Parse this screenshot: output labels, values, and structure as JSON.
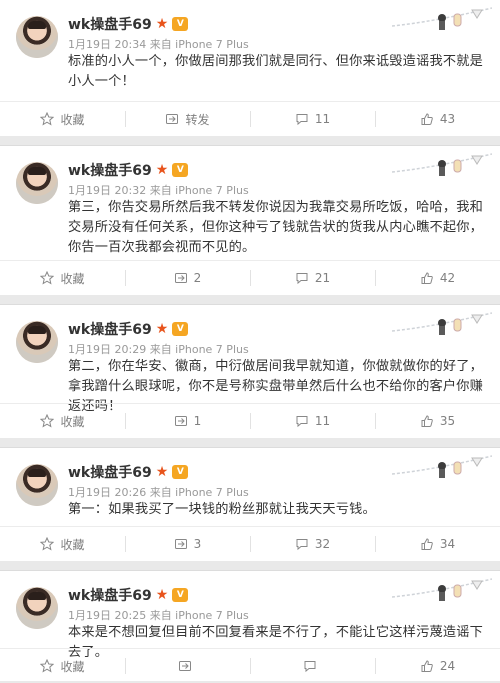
{
  "posts": [
    {
      "user": "wk操盘手69",
      "vip": "V",
      "time": "1月19日 20:34 来自 iPhone 7 Plus",
      "text": "标准的小人一个，你做居间那我们就是同行、但你来诋毁造谣我不就是小人一个！",
      "actions": {
        "collect": "收藏",
        "repost": "转发",
        "comment": "11",
        "like": "43"
      }
    },
    {
      "user": "wk操盘手69",
      "vip": "V",
      "time": "1月19日 20:32 来自 iPhone 7 Plus",
      "text": "第三，你告交易所然后我不转发你说因为我靠交易所吃饭，哈哈，我和交易所没有任何关系，但你这种亏了钱就告状的货我从内心瞧不起你，你告一百次我都会视而不见的。",
      "actions": {
        "collect": "收藏",
        "repost": "2",
        "comment": "21",
        "like": "42"
      }
    },
    {
      "user": "wk操盘手69",
      "vip": "V",
      "time": "1月19日 20:29 来自 iPhone 7 Plus",
      "text": "第二，你在华安、徽商，中衍做居间我早就知道，你做就做你的好了，拿我蹭什么眼球呢，你不是号称实盘带单然后什么也不给你的客户你赚返还吗！",
      "actions": {
        "collect": "收藏",
        "repost": "1",
        "comment": "11",
        "like": "35"
      }
    },
    {
      "user": "wk操盘手69",
      "vip": "V",
      "time": "1月19日 20:26 来自 iPhone 7 Plus",
      "text": "第一：如果我买了一块钱的粉丝那就让我天天亏钱。",
      "actions": {
        "collect": "收藏",
        "repost": "3",
        "comment": "32",
        "like": "34"
      }
    },
    {
      "user": "wk操盘手69",
      "vip": "V",
      "time": "1月19日 20:25 来自 iPhone 7 Plus",
      "text": "本来是不想回复但目前不回复看来是不行了，不能让它这样污蔑造谣下去了。",
      "actions": {
        "collect": "收藏",
        "repost": "",
        "comment": "",
        "like": "24"
      }
    }
  ],
  "icons": {
    "collect": "star-outline-icon",
    "repost": "repost-icon",
    "comment": "comment-icon",
    "like": "thumbs-up-icon"
  },
  "colors": {
    "star": "#e8541c",
    "vip": "#f5a623",
    "meta": "#999999"
  }
}
